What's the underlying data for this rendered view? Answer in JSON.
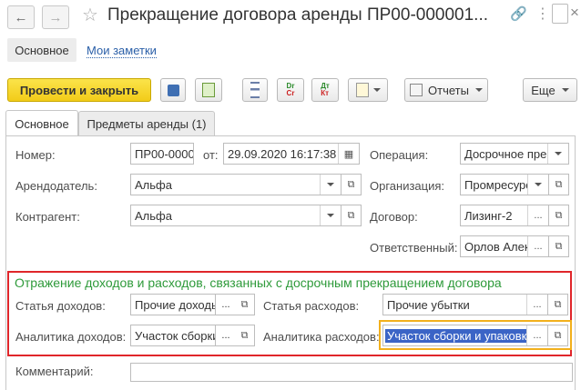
{
  "window": {
    "title": "Прекращение договора аренды ПР00-000001..."
  },
  "nav": {
    "back_icon": "arrow-left-icon",
    "forward_icon": "arrow-right-icon",
    "star_icon": "star-icon",
    "link_icon": "link-icon",
    "menu_icon": "kebab-icon",
    "close_icon": "close-icon"
  },
  "sections": {
    "main": "Основное",
    "notes": "Мои заметки"
  },
  "toolbar": {
    "post_close": "Провести и закрыть",
    "reports": "Отчеты",
    "more": "Еще"
  },
  "tabs": {
    "main": "Основное",
    "items": "Предметы аренды (1)"
  },
  "form": {
    "number_label": "Номер:",
    "number_value": "ПР00-0000",
    "from_label": "от:",
    "date_value": "29.09.2020 16:17:38",
    "operation_label": "Операция:",
    "operation_value": "Досрочное пре",
    "lessor_label": "Арендодатель:",
    "lessor_value": "Альфа",
    "organization_label": "Организация:",
    "organization_value": "Промресурс",
    "counterparty_label": "Контрагент:",
    "counterparty_value": "Альфа",
    "contract_label": "Договор:",
    "contract_value": "Лизинг-2",
    "responsible_label": "Ответственный:",
    "responsible_value": "Орлов Алек",
    "comment_label": "Комментарий:",
    "comment_value": ""
  },
  "reflection": {
    "header": "Отражение доходов и расходов, связанных с досрочным прекращением договора",
    "income_item_label": "Статья доходов:",
    "income_item_value": "Прочие доходы",
    "expense_item_label": "Статья расходов:",
    "expense_item_value": "Прочие убытки",
    "income_analytics_label": "Аналитика доходов:",
    "income_analytics_value": "Участок сборки",
    "expense_analytics_label": "Аналитика расходов:",
    "expense_analytics_value": "Участок сборки и упаковки"
  },
  "colors": {
    "accent_yellow": "#f2cc19",
    "highlight_red": "#e0262a",
    "focus_orange": "#f2b01c",
    "header_green": "#2e9a3a",
    "selection_blue": "#3b64c6"
  }
}
